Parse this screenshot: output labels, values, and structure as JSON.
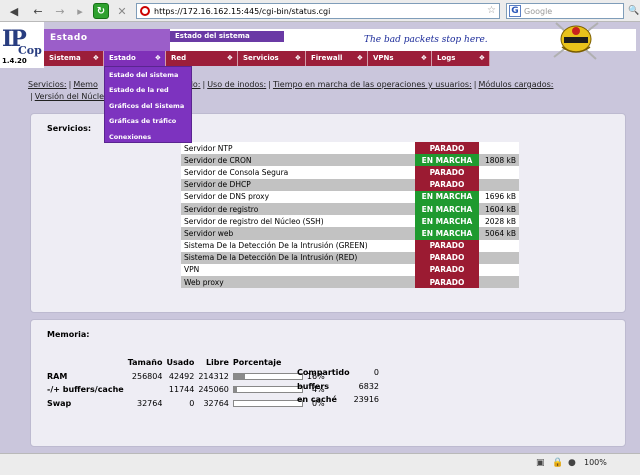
{
  "browser": {
    "url": "https://172.16.162.15:445/cgi-bin/status.cgi",
    "search_placeholder": "Google",
    "zoom": "100%"
  },
  "header": {
    "logo_top": "IP",
    "logo_bottom": "Cop",
    "version": "1.4.20",
    "title": "Estado",
    "subtitle": "Estado del sistema",
    "tagline": "The bad packets stop here."
  },
  "nav": [
    {
      "label": "Sistema",
      "active": false
    },
    {
      "label": "Estado",
      "active": true
    },
    {
      "label": "Red",
      "active": false
    },
    {
      "label": "Servicios",
      "active": false
    },
    {
      "label": "Firewall",
      "active": false
    },
    {
      "label": "VPNs",
      "active": false
    },
    {
      "label": "Logs",
      "active": false
    }
  ],
  "dropdown": [
    "Estado del sistema",
    "Estado de la red",
    "Gráficos del Sistema",
    "Gráficas de tráfico",
    "Conexiones"
  ],
  "sublinks": [
    "Servicios:",
    "Memo",
    "co usado:",
    "Uso de inodos:",
    "Tiempo en marcha de las operaciones y usuarios:",
    "Módulos cargados:",
    "Versión del Núcleo"
  ],
  "services": {
    "title": "Servicios:",
    "rows": [
      {
        "name": "Servidor NTP",
        "status": "PARADO",
        "running": false,
        "memory": ""
      },
      {
        "name": "Servidor de CRON",
        "status": "EN MARCHA",
        "running": true,
        "memory": "1808 kB"
      },
      {
        "name": "Servidor de Consola Segura",
        "status": "PARADO",
        "running": false,
        "memory": ""
      },
      {
        "name": "Servidor de DHCP",
        "status": "PARADO",
        "running": false,
        "memory": ""
      },
      {
        "name": "Servidor de DNS proxy",
        "status": "EN MARCHA",
        "running": true,
        "memory": "1696 kB"
      },
      {
        "name": "Servidor de registro",
        "status": "EN MARCHA",
        "running": true,
        "memory": "1604 kB"
      },
      {
        "name": "Servidor de registro del Núcleo (SSH)",
        "status": "EN MARCHA",
        "running": true,
        "memory": "2028 kB"
      },
      {
        "name": "Servidor web",
        "status": "EN MARCHA",
        "running": true,
        "memory": "5064 kB"
      },
      {
        "name": "Sistema De la Detección De la Intrusión (GREEN)",
        "status": "PARADO",
        "running": false,
        "memory": ""
      },
      {
        "name": "Sistema De la Detección De la Intrusión (RED)",
        "status": "PARADO",
        "running": false,
        "memory": ""
      },
      {
        "name": "VPN",
        "status": "PARADO",
        "running": false,
        "memory": ""
      },
      {
        "name": "Web proxy",
        "status": "PARADO",
        "running": false,
        "memory": ""
      }
    ]
  },
  "memory": {
    "title": "Memoria:",
    "headers": [
      "Tamaño",
      "Usado",
      "Libre",
      "Porcentaje"
    ],
    "rows": [
      {
        "label": "RAM",
        "size": "256804",
        "used": "42492",
        "free": "214312",
        "percent": "16%",
        "fraction": 0.16
      },
      {
        "label": "-/+ buffers/cache",
        "size": "",
        "used": "11744",
        "free": "245060",
        "percent": "4%",
        "fraction": 0.04
      },
      {
        "label": "Swap",
        "size": "32764",
        "used": "0",
        "free": "32764",
        "percent": "0%",
        "fraction": 0.0
      }
    ],
    "extra": [
      {
        "label": "Compartido",
        "value": "0"
      },
      {
        "label": "buffers",
        "value": "6832"
      },
      {
        "label": "en caché",
        "value": "23916"
      }
    ]
  }
}
